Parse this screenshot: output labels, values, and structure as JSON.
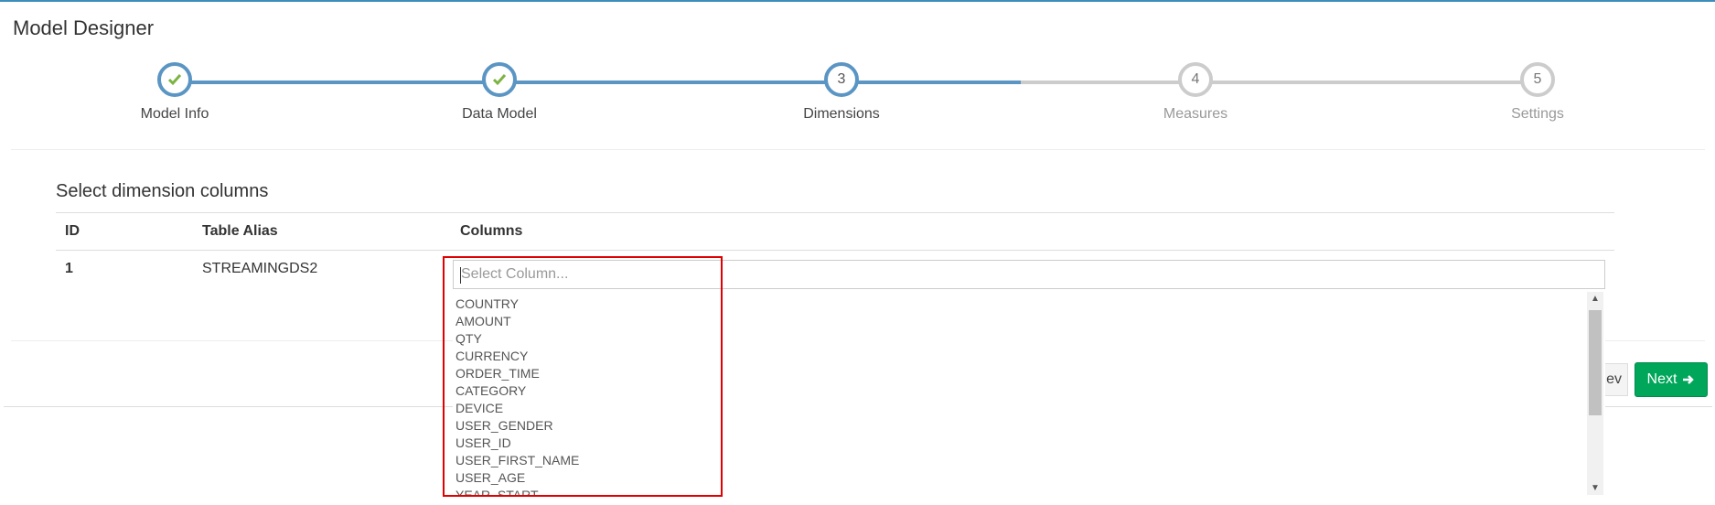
{
  "panel": {
    "title": "Model Designer"
  },
  "wizard": {
    "steps": [
      {
        "number": "1",
        "label": "Model Info",
        "state": "done"
      },
      {
        "number": "2",
        "label": "Data Model",
        "state": "done"
      },
      {
        "number": "3",
        "label": "Dimensions",
        "state": "active"
      },
      {
        "number": "4",
        "label": "Measures",
        "state": "todo"
      },
      {
        "number": "5",
        "label": "Settings",
        "state": "todo"
      }
    ]
  },
  "section": {
    "title": "Select dimension columns"
  },
  "table": {
    "headers": [
      "ID",
      "Table Alias",
      "Columns"
    ],
    "rows": [
      {
        "id": "1",
        "alias": "STREAMINGDS2"
      }
    ]
  },
  "select": {
    "placeholder": "Select Column...",
    "options": [
      "COUNTRY",
      "AMOUNT",
      "QTY",
      "CURRENCY",
      "ORDER_TIME",
      "CATEGORY",
      "DEVICE",
      "USER_GENDER",
      "USER_ID",
      "USER_FIRST_NAME",
      "USER_AGE",
      "YEAR_START"
    ]
  },
  "buttons": {
    "prev_label": "ev",
    "next_label": "Next"
  },
  "colors": {
    "accent": "#5a95c3",
    "success": "#00a65a",
    "check": "#7cb342",
    "highlight": "#e00000"
  }
}
